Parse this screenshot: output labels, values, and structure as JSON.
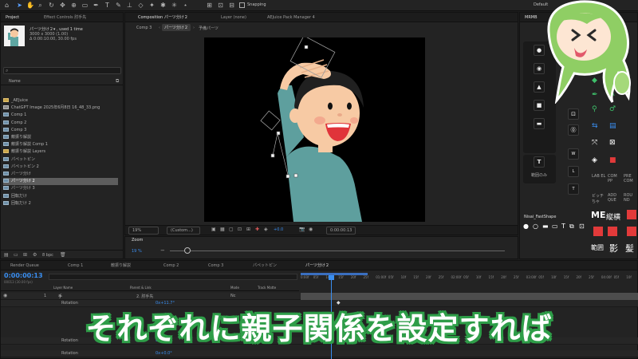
{
  "toolbar": {
    "snapping_label": "Snapping",
    "workspace": "Default"
  },
  "project": {
    "tab_label": "Project",
    "effect_controls_label": "Effect Controls 肘手先",
    "comp_name": "パーツ分け２▾ , used 1 time",
    "comp_size": "3000 x 3000 (1.00)",
    "comp_duration": "Δ 0:00:10:00, 30.00 fps",
    "search_placeholder": "",
    "column_name": "Name",
    "items": [
      {
        "label": "_AEJuice",
        "type": "folder"
      },
      {
        "label": "ChatGPT Image 2025年6月8日 16_48_33.png",
        "type": "image"
      },
      {
        "label": "Comp 1",
        "type": "comp"
      },
      {
        "label": "Comp 2",
        "type": "comp"
      },
      {
        "label": "Comp 3",
        "type": "comp"
      },
      {
        "label": "敵振り解説",
        "type": "comp"
      },
      {
        "label": "敵振り解説 Comp 1",
        "type": "comp"
      },
      {
        "label": "敵振り解説 Layers",
        "type": "folder"
      },
      {
        "label": "パペットピン",
        "type": "comp"
      },
      {
        "label": "パペットピン 2",
        "type": "comp"
      },
      {
        "label": "パーツ分け",
        "type": "comp"
      },
      {
        "label": "パーツ分け 2",
        "type": "comp"
      },
      {
        "label": "パーツ分け 3",
        "type": "comp"
      },
      {
        "label": "回転だけ",
        "type": "comp"
      },
      {
        "label": "回転だけ 2",
        "type": "comp"
      }
    ],
    "bpc": "8 bpc"
  },
  "composition": {
    "tab_label": "Composition パーツ分け２",
    "layer_tab": "Layer (none)",
    "pack_manager": "AEJuice Pack Manager 4",
    "breadcrumbs": [
      "Comp 3",
      "パーツ分け２",
      "予備パーツ"
    ],
    "zoom": "19%",
    "resolution": "(Custom...)",
    "exposure": "+0.0",
    "timecode": "0:00:00:13"
  },
  "zoom_panel": {
    "label": "Zoom",
    "value": "19 %"
  },
  "right_panel": {
    "tab_label": "MRMB",
    "text_button": "T",
    "text_hint": "範囲のみ",
    "right_labels": [
      "LAB EL",
      "COM PP",
      "PRE COM",
      "ビッチ ちゃ",
      "ADD QUE",
      "ROU ND"
    ],
    "nisai_label": "Nisai_FastShape",
    "kanji_labels": [
      "ME",
      "縦横",
      "範囲",
      "影",
      "髪"
    ]
  },
  "timeline": {
    "render_queue": "Render Queue",
    "tabs": [
      "Comp 1",
      "敵振り解説",
      "Comp 2",
      "Comp 3",
      "パペットピン",
      "パーツ分け２"
    ],
    "timecode": "0:00:00:13",
    "frames": "00013 (30.00 fps)",
    "columns": {
      "layer_name": "Layer Name",
      "parent": "Parent & Link",
      "mode": "Mode",
      "track_matte": "Track Matte"
    },
    "layers": [
      {
        "num": "1",
        "name": "手",
        "parent": "2. 肘手先",
        "mode": "Nc"
      },
      {
        "prop": "Rotation",
        "value": "0x+11.7°"
      },
      {
        "prop": "Rotation",
        "value": "0x+0.0°"
      },
      {
        "prop": "Rotation",
        "value": "0x+0.0°"
      }
    ],
    "ruler": [
      "0:00f",
      "05f",
      "10f",
      "15f",
      "20f",
      "25f",
      "01:00f",
      "05f",
      "10f",
      "15f",
      "20f",
      "25f",
      "02:00f",
      "05f",
      "10f",
      "15f",
      "20f",
      "25f",
      "03:00f",
      "05f",
      "10f",
      "15f",
      "20f",
      "25f",
      "04:00f",
      "05f",
      "10f"
    ]
  },
  "caption": "それぞれに親子関係を設定すれば",
  "colors": {
    "caption_outline": "#2e9d48",
    "mascot_hair": "#8fce64",
    "timecode_blue": "#3a8ef0",
    "accent_red": "#e23a3a"
  }
}
